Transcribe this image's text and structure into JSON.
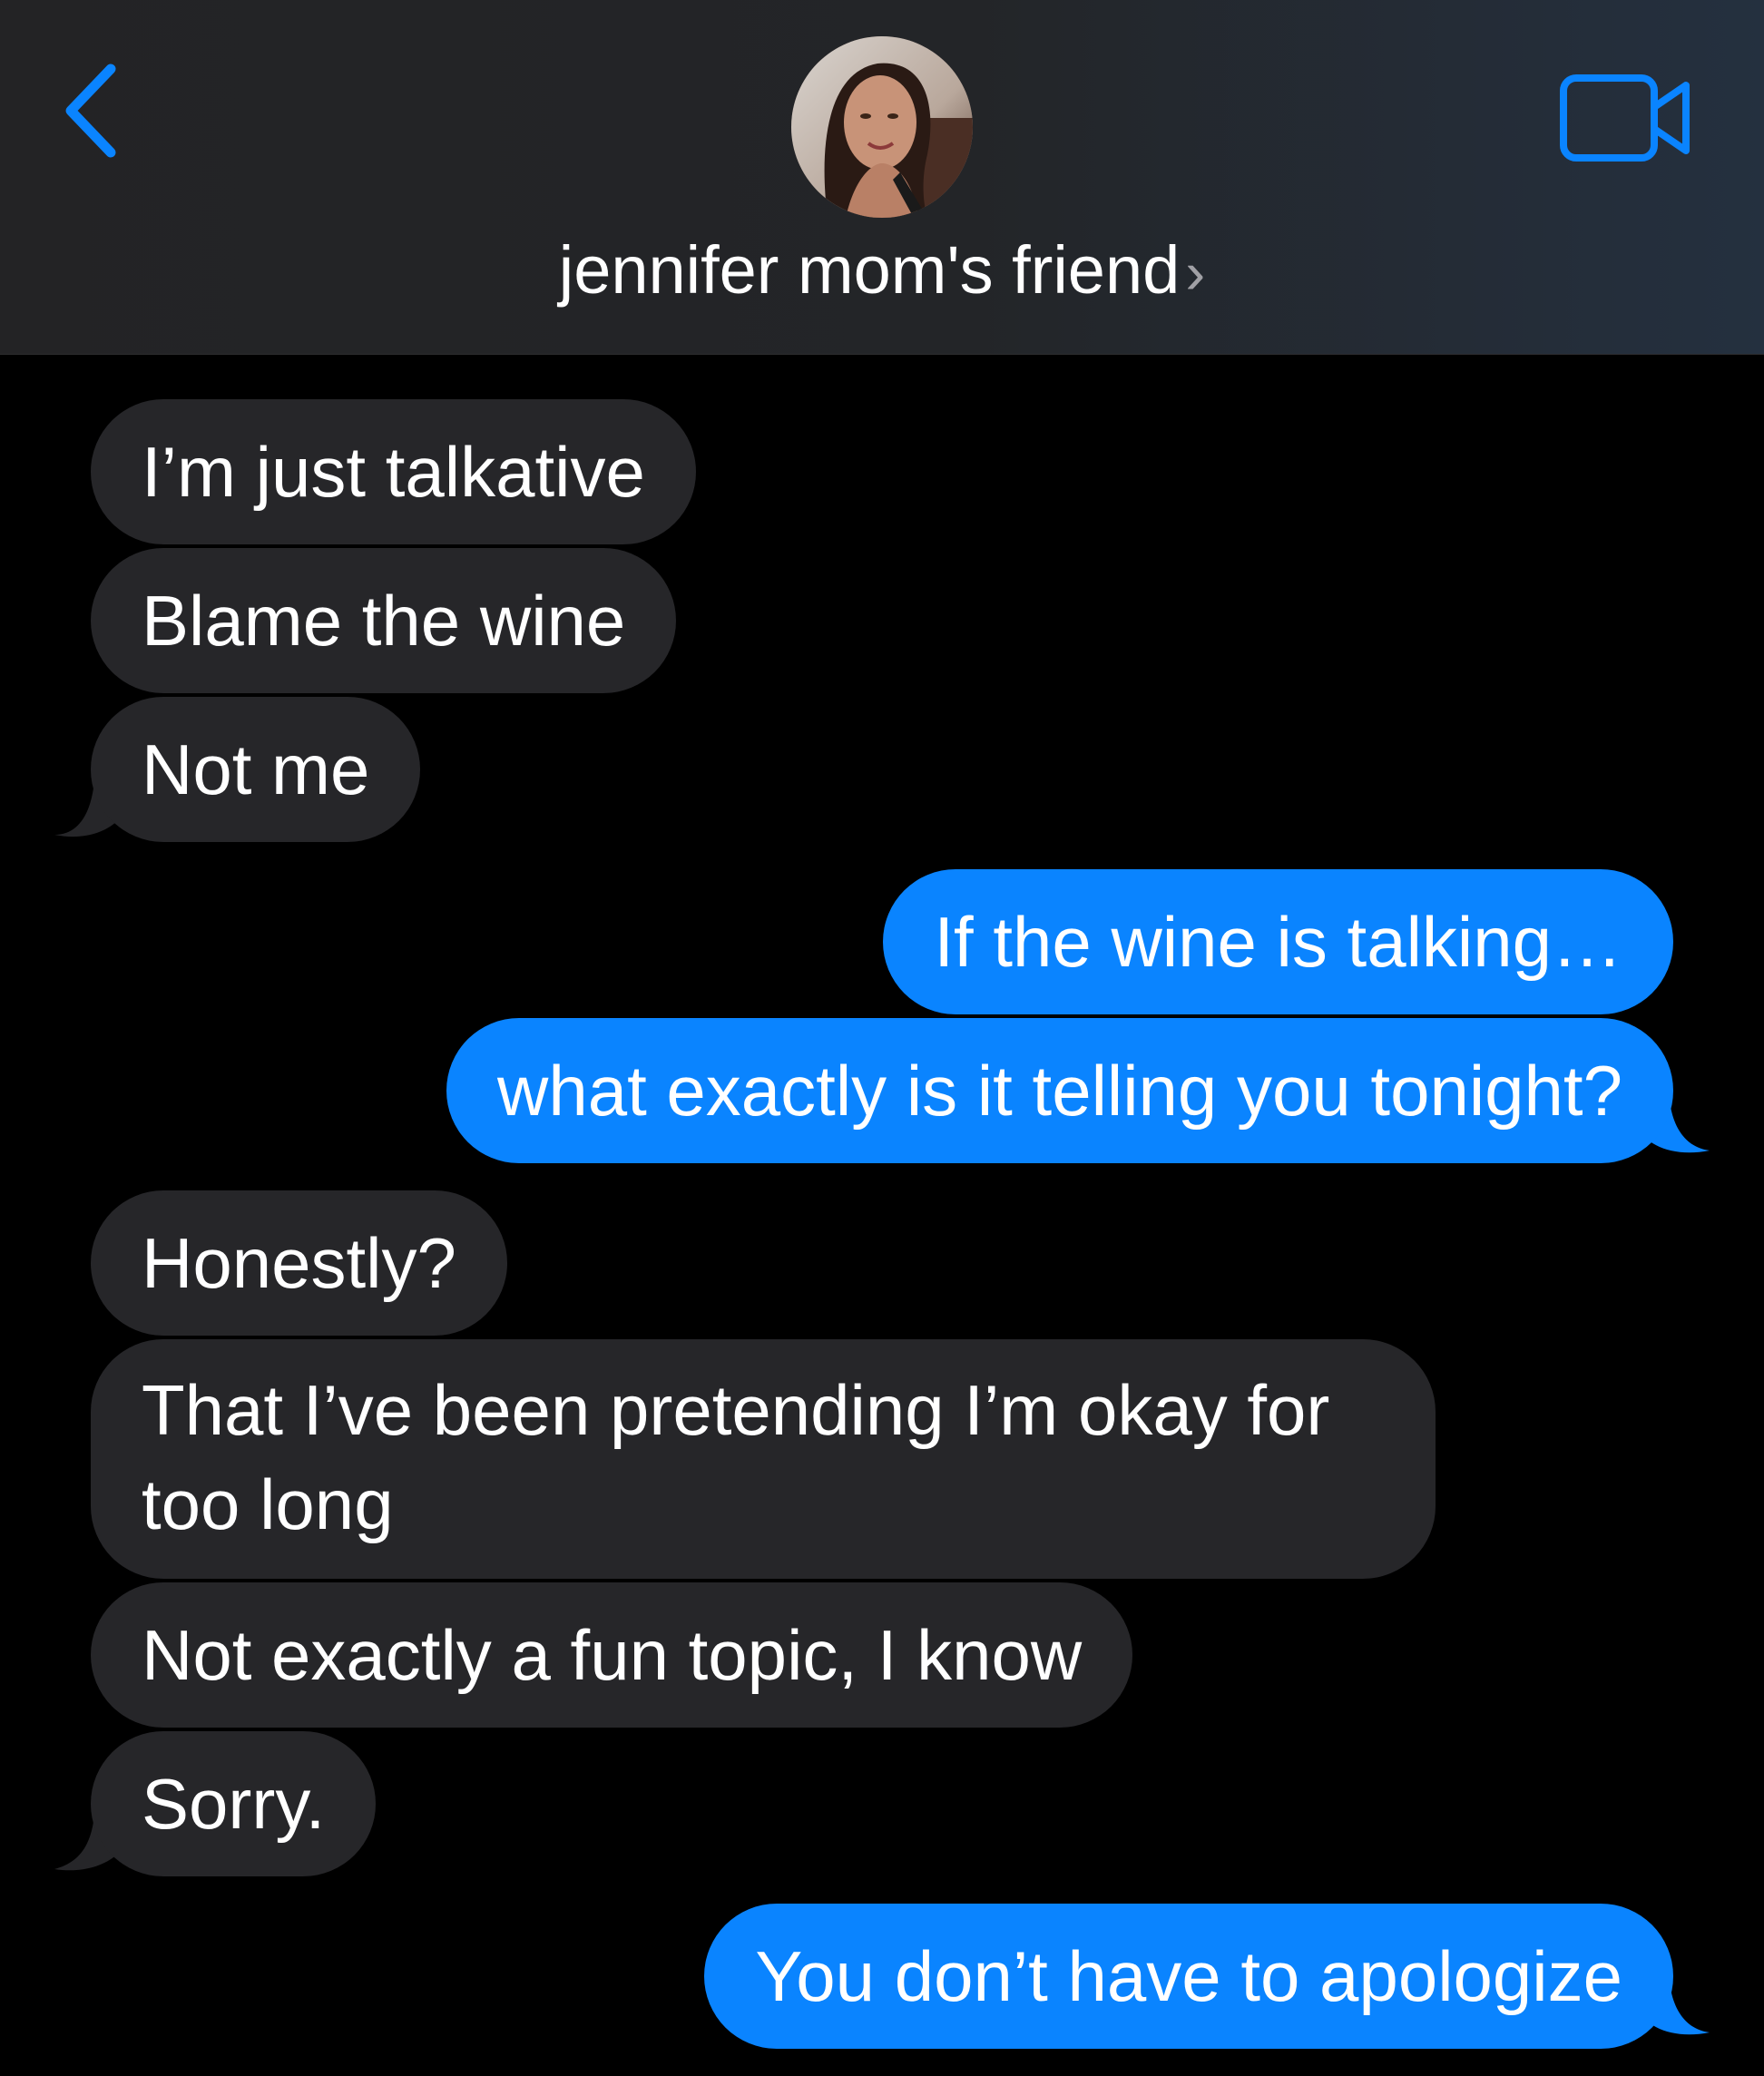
{
  "header": {
    "contact_name": "jennifer mom's friend",
    "name_chevron": "›",
    "back_icon": "chevron-left-icon",
    "video_icon": "video-camera-icon",
    "accent_color": "#0a84ff"
  },
  "messages": [
    {
      "direction": "incoming",
      "text": "I’m just talkative"
    },
    {
      "direction": "incoming",
      "text": "Blame the wine"
    },
    {
      "direction": "incoming",
      "text": "Not me"
    },
    {
      "direction": "outgoing",
      "text": "If the wine is talking…"
    },
    {
      "direction": "outgoing",
      "text": "what exactly is it telling you tonight?"
    },
    {
      "direction": "incoming",
      "text": "Honestly?"
    },
    {
      "direction": "incoming",
      "text_line1": "That I’ve been pretending I’m okay for",
      "text_line2": "too long"
    },
    {
      "direction": "incoming",
      "text": "Not exactly a fun topic, I know"
    },
    {
      "direction": "incoming",
      "text": "Sorry."
    },
    {
      "direction": "outgoing",
      "text": "You don’t have to apologize"
    }
  ],
  "colors": {
    "incoming_bubble": "#262629",
    "outgoing_bubble": "#0a84ff",
    "background": "#000000"
  }
}
